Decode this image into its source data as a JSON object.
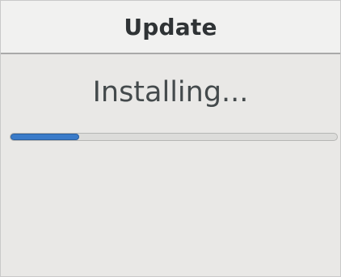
{
  "dialog": {
    "title": "Update",
    "status_text": "Installing..."
  },
  "progress": {
    "fraction": 0.21
  },
  "colors": {
    "accent": "#3a7bc9",
    "background": "#e9e8e6",
    "titlebar": "#f1f1f0",
    "text": "#2f3335"
  }
}
